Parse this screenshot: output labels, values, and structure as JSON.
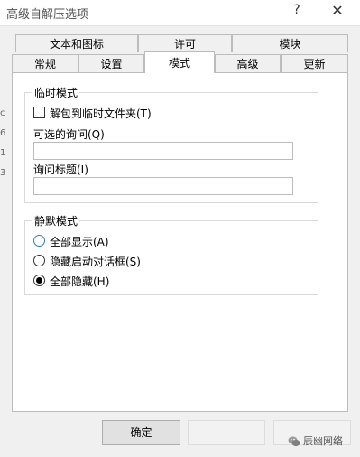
{
  "window": {
    "title": "高级自解压选项",
    "help_label": "?",
    "close_label": "✕",
    "edge_marks": [
      "c",
      "6",
      "1",
      "3"
    ]
  },
  "tabs": {
    "row1": [
      {
        "label": "文本和图标"
      },
      {
        "label": "许可"
      },
      {
        "label": "模块"
      }
    ],
    "row2": [
      {
        "label": "常规"
      },
      {
        "label": "设置"
      },
      {
        "label": "模式",
        "active": true
      },
      {
        "label": "高级"
      },
      {
        "label": "更新"
      }
    ]
  },
  "temp_mode": {
    "title": "临时模式",
    "unpack_to_temp": {
      "label": "解包到临时文件夹(T)",
      "checked": false
    },
    "optional_question": {
      "label": "可选的询问(Q)",
      "value": ""
    },
    "question_title": {
      "label": "询问标题(I)",
      "value": ""
    }
  },
  "silent_mode": {
    "title": "静默模式",
    "options": [
      {
        "label": "全部显示(A)",
        "checked": false
      },
      {
        "label": "隐藏启动对话框(S)",
        "checked": false
      },
      {
        "label": "全部隐藏(H)",
        "checked": true
      }
    ]
  },
  "buttons": {
    "ok_label": "确定"
  },
  "watermark": {
    "text": "辰幽网络",
    "icon": "wechat-icon"
  }
}
